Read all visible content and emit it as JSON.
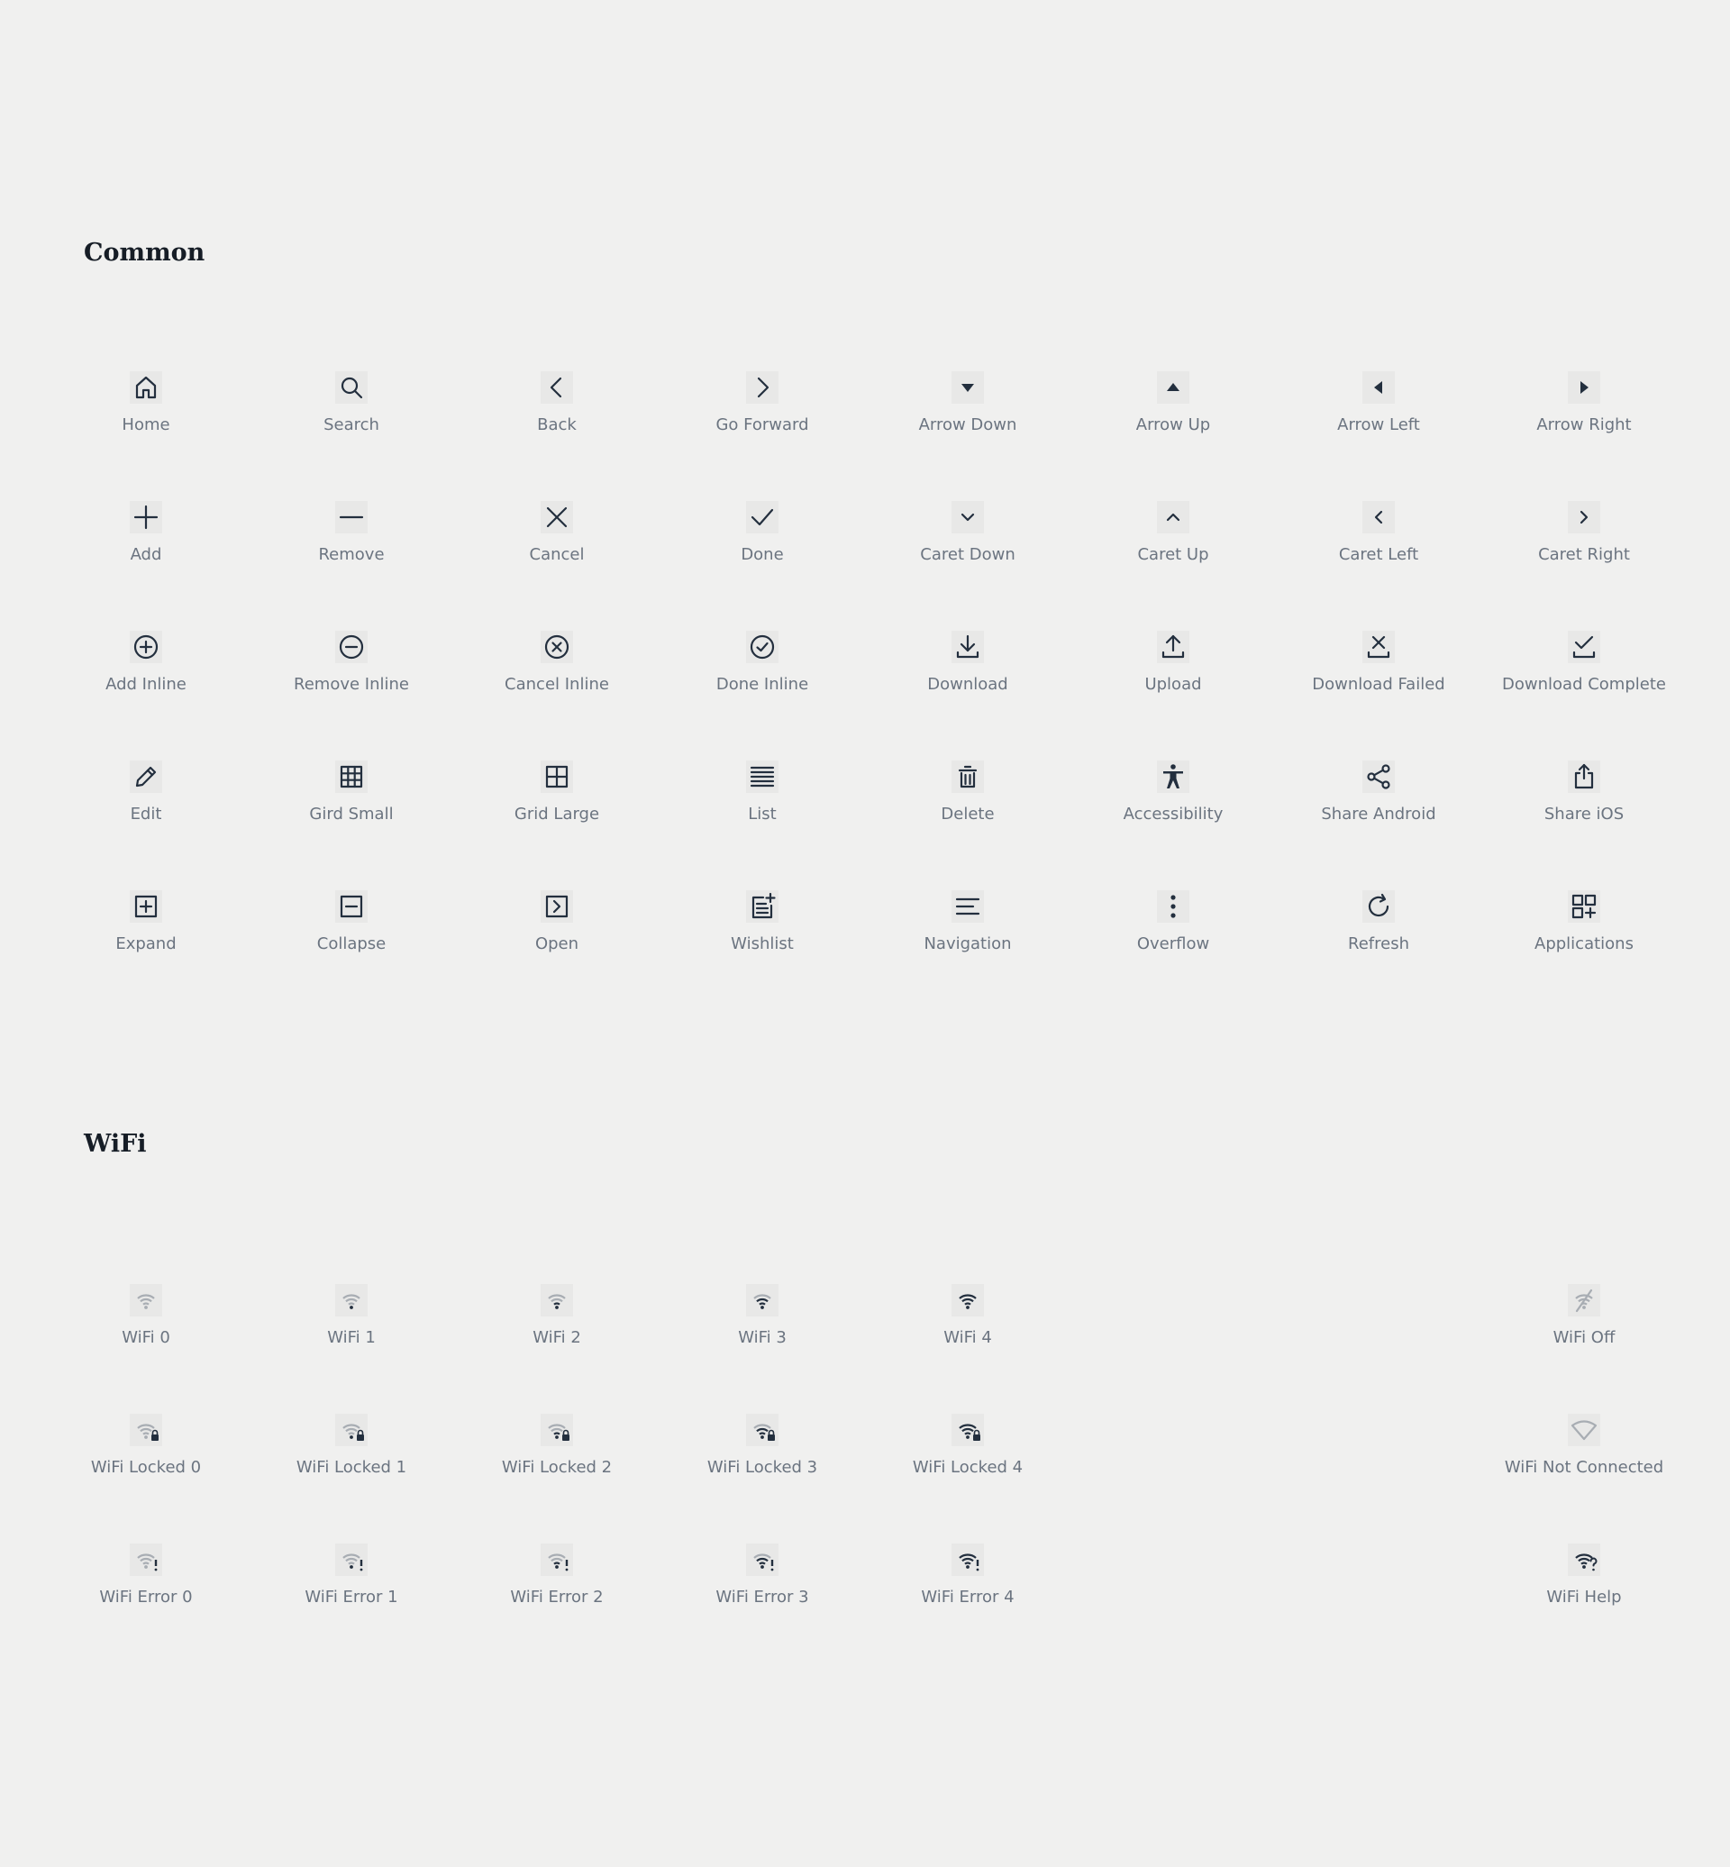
{
  "sections": [
    {
      "title": "Common",
      "items": [
        {
          "label": "Home",
          "icon": "home-icon"
        },
        {
          "label": "Search",
          "icon": "search-icon"
        },
        {
          "label": "Back",
          "icon": "back-icon"
        },
        {
          "label": "Go Forward",
          "icon": "go-forward-icon"
        },
        {
          "label": "Arrow Down",
          "icon": "arrow-down-icon"
        },
        {
          "label": "Arrow Up",
          "icon": "arrow-up-icon"
        },
        {
          "label": "Arrow Left",
          "icon": "arrow-left-icon"
        },
        {
          "label": "Arrow Right",
          "icon": "arrow-right-icon"
        },
        {
          "label": "Add",
          "icon": "add-icon"
        },
        {
          "label": "Remove",
          "icon": "remove-icon"
        },
        {
          "label": "Cancel",
          "icon": "cancel-icon"
        },
        {
          "label": "Done",
          "icon": "done-icon"
        },
        {
          "label": "Caret Down",
          "icon": "caret-down-icon"
        },
        {
          "label": "Caret Up",
          "icon": "caret-up-icon"
        },
        {
          "label": "Caret Left",
          "icon": "caret-left-icon"
        },
        {
          "label": "Caret Right",
          "icon": "caret-right-icon"
        },
        {
          "label": "Add Inline",
          "icon": "add-inline-icon"
        },
        {
          "label": "Remove Inline",
          "icon": "remove-inline-icon"
        },
        {
          "label": "Cancel Inline",
          "icon": "cancel-inline-icon"
        },
        {
          "label": "Done Inline",
          "icon": "done-inline-icon"
        },
        {
          "label": "Download",
          "icon": "download-icon"
        },
        {
          "label": "Upload",
          "icon": "upload-icon"
        },
        {
          "label": "Download Failed",
          "icon": "download-failed-icon"
        },
        {
          "label": "Download Complete",
          "icon": "download-complete-icon"
        },
        {
          "label": "Edit",
          "icon": "edit-icon"
        },
        {
          "label": "Gird Small",
          "icon": "grid-small-icon"
        },
        {
          "label": "Grid Large",
          "icon": "grid-large-icon"
        },
        {
          "label": "List",
          "icon": "list-icon"
        },
        {
          "label": "Delete",
          "icon": "delete-icon"
        },
        {
          "label": "Accessibility",
          "icon": "accessibility-icon"
        },
        {
          "label": "Share Android",
          "icon": "share-android-icon"
        },
        {
          "label": "Share iOS",
          "icon": "share-ios-icon"
        },
        {
          "label": "Expand",
          "icon": "expand-icon"
        },
        {
          "label": "Collapse",
          "icon": "collapse-icon"
        },
        {
          "label": "Open",
          "icon": "open-icon"
        },
        {
          "label": "Wishlist",
          "icon": "wishlist-icon"
        },
        {
          "label": "Navigation",
          "icon": "navigation-icon"
        },
        {
          "label": "Overflow",
          "icon": "overflow-icon"
        },
        {
          "label": "Refresh",
          "icon": "refresh-icon"
        },
        {
          "label": "Applications",
          "icon": "applications-icon"
        }
      ]
    },
    {
      "title": "WiFi",
      "items": [
        {
          "label": "WiFi 0",
          "icon": "wifi-0-icon"
        },
        {
          "label": "WiFi 1",
          "icon": "wifi-1-icon"
        },
        {
          "label": "WiFi 2",
          "icon": "wifi-2-icon"
        },
        {
          "label": "WiFi 3",
          "icon": "wifi-3-icon"
        },
        {
          "label": "WiFi 4",
          "icon": "wifi-4-icon"
        },
        {
          "label": "WiFi Off",
          "icon": "wifi-off-icon"
        },
        {
          "label": "WiFi Locked 0",
          "icon": "wifi-locked-0-icon"
        },
        {
          "label": "WiFi Locked 1",
          "icon": "wifi-locked-1-icon"
        },
        {
          "label": "WiFi Locked 2",
          "icon": "wifi-locked-2-icon"
        },
        {
          "label": "WiFi Locked 3",
          "icon": "wifi-locked-3-icon"
        },
        {
          "label": "WiFi Locked 4",
          "icon": "wifi-locked-4-icon"
        },
        {
          "label": "WiFi Not Connected",
          "icon": "wifi-not-connected-icon"
        },
        {
          "label": "WiFi Error 0",
          "icon": "wifi-error-0-icon"
        },
        {
          "label": "WiFi Error 1",
          "icon": "wifi-error-1-icon"
        },
        {
          "label": "WiFi Error 2",
          "icon": "wifi-error-2-icon"
        },
        {
          "label": "WiFi Error 3",
          "icon": "wifi-error-3-icon"
        },
        {
          "label": "WiFi Error 4",
          "icon": "wifi-error-4-icon"
        },
        {
          "label": "WiFi Help",
          "icon": "wifi-help-icon"
        }
      ]
    }
  ],
  "colors": {
    "background": "#f0f0ef",
    "icon": "#232f3e",
    "icon_faded": "#a8adb3",
    "label": "#6b7480",
    "title": "#161d26"
  }
}
